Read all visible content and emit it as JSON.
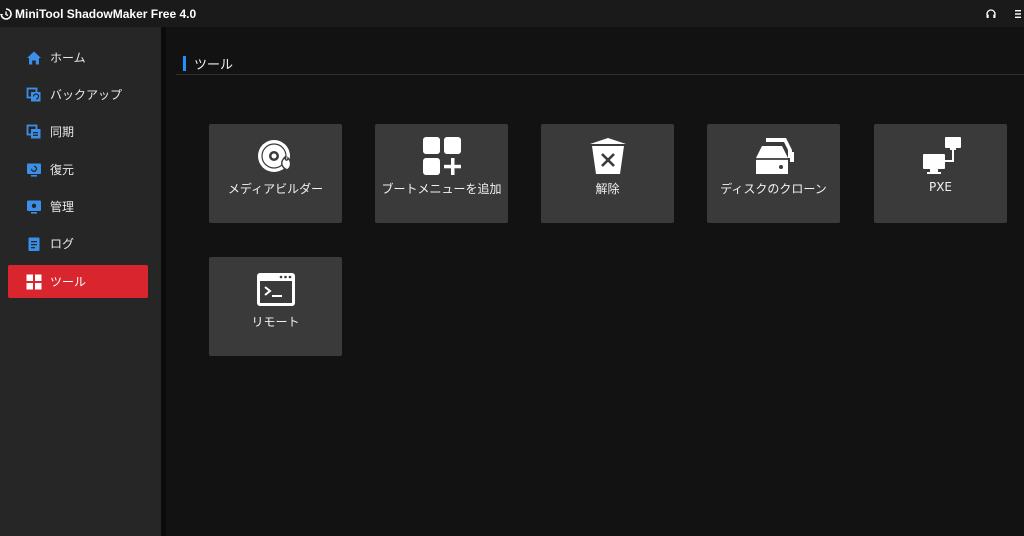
{
  "window": {
    "title": "MiniTool ShadowMaker Free 4.0"
  },
  "sidebar": {
    "items": [
      {
        "label": "ホーム",
        "icon": "home-icon",
        "active": false
      },
      {
        "label": "バックアップ",
        "icon": "backup-icon",
        "active": false
      },
      {
        "label": "同期",
        "icon": "sync-icon",
        "active": false
      },
      {
        "label": "復元",
        "icon": "restore-icon",
        "active": false
      },
      {
        "label": "管理",
        "icon": "manage-icon",
        "active": false
      },
      {
        "label": "ログ",
        "icon": "log-icon",
        "active": false
      },
      {
        "label": "ツール",
        "icon": "tools-icon",
        "active": true
      }
    ]
  },
  "main": {
    "section_title": "ツール",
    "tools": [
      {
        "label": "メディアビルダー",
        "icon": "disc-fire-icon"
      },
      {
        "label": "ブートメニューを追加",
        "icon": "grid-plus-icon"
      },
      {
        "label": "解除",
        "icon": "bin-x-icon"
      },
      {
        "label": "ディスクのクローン",
        "icon": "disk-clone-icon"
      },
      {
        "label": "PXE",
        "icon": "network-computers-icon"
      },
      {
        "label": "リモート",
        "icon": "terminal-icon"
      }
    ]
  },
  "colors": {
    "accent_active": "#d9262e",
    "accent_blue": "#1e90ff",
    "tile_bg": "#3a3a3a",
    "sidebar_bg": "#262626",
    "main_bg": "#121212"
  }
}
